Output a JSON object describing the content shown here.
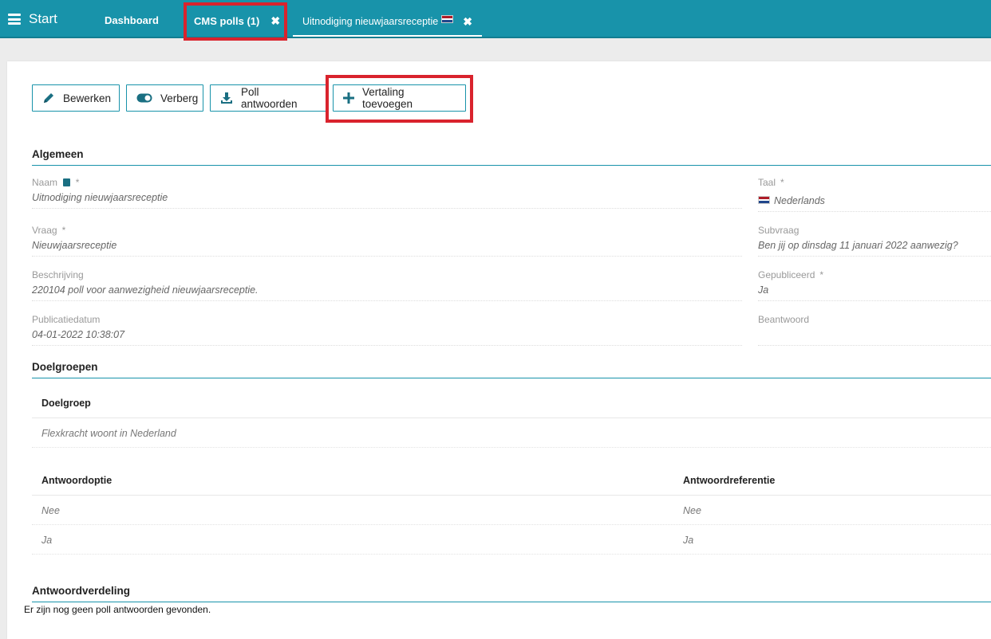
{
  "topbar": {
    "start_label": "Start",
    "tabs": [
      {
        "label": "Dashboard"
      },
      {
        "label": "CMS polls (1)",
        "close": "✖"
      },
      {
        "label": "Uitnodiging nieuwjaarsreceptie",
        "close": "✖"
      }
    ]
  },
  "actions": {
    "edit": "Bewerken",
    "hide": "Verberg",
    "poll_answers": "Poll antwoorden",
    "add_translation": "Vertaling toevoegen"
  },
  "general": {
    "title": "Algemeen",
    "fields": {
      "naam": {
        "label": "Naam",
        "required": "*",
        "value": "Uitnodiging nieuwjaarsreceptie"
      },
      "vraag": {
        "label": "Vraag",
        "required": "*",
        "value": "Nieuwjaarsreceptie"
      },
      "beschrijving": {
        "label": "Beschrijving",
        "value": "220104 poll voor aanwezigheid nieuwjaarsreceptie."
      },
      "publicatiedatum": {
        "label": "Publicatiedatum",
        "value": "04-01-2022 10:38:07"
      },
      "taal": {
        "label": "Taal",
        "required": "*",
        "value": "Nederlands"
      },
      "subvraag": {
        "label": "Subvraag",
        "value": "Ben jij op dinsdag 11 januari 2022 aanwezig?"
      },
      "gepubliceerd": {
        "label": "Gepubliceerd",
        "required": "*",
        "value": "Ja"
      },
      "beantwoord": {
        "label": "Beantwoord",
        "value": ""
      }
    }
  },
  "targets": {
    "title": "Doelgroepen",
    "header": "Doelgroep",
    "rows": [
      "Flexkracht woont in Nederland"
    ]
  },
  "answers": {
    "headers": [
      "Antwoordoptie",
      "Antwoordreferentie"
    ],
    "rows": [
      [
        "Nee",
        "Nee"
      ],
      [
        "Ja",
        "Ja"
      ]
    ]
  },
  "distribution": {
    "title": "Antwoordverdeling",
    "empty_text": "Er zijn nog geen poll antwoorden gevonden."
  },
  "colors": {
    "brand": "#1893aa",
    "highlight": "#d9232d",
    "flag": [
      "#ae1c28",
      "#ffffff",
      "#21468b"
    ]
  }
}
